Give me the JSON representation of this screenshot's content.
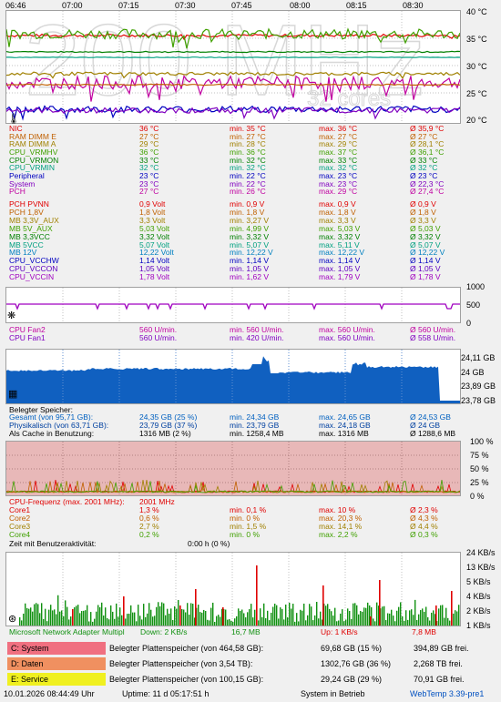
{
  "colors": {
    "red": "#e00000",
    "green": "#00a000",
    "purple": "#a000c0",
    "blue": "#0000e0",
    "olive": "#a09000",
    "memfill": "#1060c0",
    "cpufill": "#e8b8b8",
    "netgreen": "#109010",
    "netred": "#e00000"
  },
  "watermark": {
    "big": "200 MHz",
    "sub": "32 cores"
  },
  "time_axis": [
    "06:46",
    "07:00",
    "07:15",
    "07:30",
    "07:45",
    "08:00",
    "08:15",
    "08:30"
  ],
  "temp_axis": [
    "40 °C",
    "35 °C",
    "30 °C",
    "25 °C",
    "20 °C"
  ],
  "temp_rows": [
    {
      "name": "NIC",
      "cur": "36 °C",
      "min": "min. 35 °C",
      "max": "max. 36 °C",
      "avg": "Ø 35,9 °C",
      "color": "#e00000"
    },
    {
      "name": "RAM DIMM E",
      "cur": "27 °C",
      "min": "min. 27 °C",
      "max": "max. 27 °C",
      "avg": "Ø 27 °C",
      "color": "#c06000"
    },
    {
      "name": "RAM DIMM A",
      "cur": "29 °C",
      "min": "min. 28 °C",
      "max": "max. 29 °C",
      "avg": "Ø 28,1 °C",
      "color": "#a08000"
    },
    {
      "name": "CPU_VRMHV",
      "cur": "36 °C",
      "min": "min. 36 °C",
      "max": "max. 37 °C",
      "avg": "Ø 36,1 °C",
      "color": "#40a000"
    },
    {
      "name": "CPU_VRMON",
      "cur": "33 °C",
      "min": "min. 32 °C",
      "max": "max. 33 °C",
      "avg": "Ø 33 °C",
      "color": "#008000"
    },
    {
      "name": "CPU_VRMIN",
      "cur": "32 °C",
      "min": "min. 32 °C",
      "max": "max. 32 °C",
      "avg": "Ø 32 °C",
      "color": "#00a080"
    },
    {
      "name": "Peripheral",
      "cur": "23 °C",
      "min": "min. 22 °C",
      "max": "max. 23 °C",
      "avg": "Ø 23 °C",
      "color": "#0000c0"
    },
    {
      "name": "System",
      "cur": "23 °C",
      "min": "min. 22 °C",
      "max": "max. 23 °C",
      "avg": "Ø 22,3 °C",
      "color": "#8000c0"
    },
    {
      "name": "PCH",
      "cur": "27 °C",
      "min": "min. 26 °C",
      "max": "max. 29 °C",
      "avg": "Ø 27,4 °C",
      "color": "#c000a0"
    }
  ],
  "volt_rows": [
    {
      "name": "PCH PVNN",
      "cur": "0,9 Volt",
      "min": "min. 0,9 V",
      "max": "max. 0,9 V",
      "avg": "Ø 0,9 V",
      "color": "#e00000"
    },
    {
      "name": "PCH 1,8V",
      "cur": "1,8 Volt",
      "min": "min. 1,8 V",
      "max": "max. 1,8 V",
      "avg": "Ø 1,8 V",
      "color": "#c06000"
    },
    {
      "name": "MB 3,3V_AUX",
      "cur": "3,3 Volt",
      "min": "min. 3,27 V",
      "max": "max. 3,3 V",
      "avg": "Ø 3,3 V",
      "color": "#a08000"
    },
    {
      "name": "MB 5V_AUX",
      "cur": "5,03 Volt",
      "min": "min. 4,99 V",
      "max": "max. 5,03 V",
      "avg": "Ø 5,03 V",
      "color": "#40a000"
    },
    {
      "name": "MB 3,3VCC",
      "cur": "3,32 Volt",
      "min": "min. 3,32 V",
      "max": "max. 3,32 V",
      "avg": "Ø 3,32 V",
      "color": "#008000"
    },
    {
      "name": "MB 5VCC",
      "cur": "5,07 Volt",
      "min": "min. 5,07 V",
      "max": "max. 5,11 V",
      "avg": "Ø 5,07 V",
      "color": "#00a080"
    },
    {
      "name": "MB 12V",
      "cur": "12,22 Volt",
      "min": "min. 12,22 V",
      "max": "max. 12,22 V",
      "avg": "Ø 12,22 V",
      "color": "#0080c0"
    },
    {
      "name": "CPU_VCCHW",
      "cur": "1,14 Volt",
      "min": "min. 1,14 V",
      "max": "max. 1,14 V",
      "avg": "Ø 1,14 V",
      "color": "#0000c0"
    },
    {
      "name": "CPU_VCCON",
      "cur": "1,05 Volt",
      "min": "min. 1,05 V",
      "max": "max. 1,05 V",
      "avg": "Ø 1,05 V",
      "color": "#6000c0"
    },
    {
      "name": "CPU_VCCIN",
      "cur": "1,78 Volt",
      "min": "min. 1,62 V",
      "max": "max. 1,79 V",
      "avg": "Ø 1,78 V",
      "color": "#a000c0"
    }
  ],
  "fan_axis": [
    "1000",
    "500",
    "0"
  ],
  "fan_rows": [
    {
      "name": "CPU Fan2",
      "cur": "560 U/min.",
      "min": "min. 560 U/min.",
      "max": "max. 560 U/min.",
      "avg": "Ø 560 U/min.",
      "color": "#c000a0"
    },
    {
      "name": "CPU Fan1",
      "cur": "560 U/min.",
      "min": "min. 420 U/min.",
      "max": "max. 560 U/min.",
      "avg": "Ø 558 U/min.",
      "color": "#8000c0"
    }
  ],
  "mem_axis": [
    "24,11 GB",
    "24 GB",
    "23,89 GB",
    "23,78 GB"
  ],
  "mem_header": "Belegter Speicher:",
  "mem_rows": [
    {
      "name": "Gesamt (von 95,71 GB):",
      "cur": "24,35 GB (25 %)",
      "min": "min. 24,34 GB",
      "max": "max. 24,65 GB",
      "avg": "Ø 24,53 GB",
      "color": "#0060c0"
    },
    {
      "name": "Physikalisch (von 63,71 GB):",
      "cur": "23,79 GB (37 %)",
      "min": "min. 23,79 GB",
      "max": "max. 24,18 GB",
      "avg": "Ø 24 GB",
      "color": "#0040a0"
    },
    {
      "name": "Als Cache in Benutzung:",
      "cur": "1316 MB (2 %)",
      "min": "min. 1258,4 MB",
      "max": "max. 1316 MB",
      "avg": "Ø 1288,6 MB",
      "color": "#000000"
    }
  ],
  "cpu_axis": [
    "100 %",
    "75 %",
    "50 %",
    "25 %",
    "0 %"
  ],
  "cpu_header": "CPU-Frequenz (max. 2001 MHz):",
  "cpu_header_val": "2001 MHz",
  "cpu_rows": [
    {
      "name": "Core1",
      "cur": "1,3 %",
      "min": "min. 0,1 %",
      "max": "max. 10 %",
      "avg": "Ø 2,3 %",
      "color": "#e00000"
    },
    {
      "name": "Core2",
      "cur": "0,6 %",
      "min": "min. 0 %",
      "max": "max. 20,3 %",
      "avg": "Ø 4,3 %",
      "color": "#c06000"
    },
    {
      "name": "Core3",
      "cur": "2,7 %",
      "min": "min. 1,5 %",
      "max": "max. 14,1 %",
      "avg": "Ø 4,4 %",
      "color": "#a08000"
    },
    {
      "name": "Core4",
      "cur": "0,2 %",
      "min": "min. 0 %",
      "max": "max. 2,2 %",
      "avg": "Ø 0,3 %",
      "color": "#40a000"
    }
  ],
  "user_activity": {
    "label": "Zeit mit Benutzeraktivität:",
    "value": "0:00 h  (0 %)"
  },
  "net_axis": [
    "24 KB/s",
    "13 KB/s",
    "5 KB/s",
    "4 KB/s",
    "2 KB/s",
    "1 KB/s"
  ],
  "net": {
    "adapter": "Microsoft Network Adapter Multipl",
    "down": "Down: 2 KB/s",
    "down_total": "16,7 MB",
    "up": "Up: 1 KB/s",
    "up_total": "7,8 MB"
  },
  "drives": [
    {
      "letter": "C: System",
      "label": "Belegter Plattenspeicher (von 464,58 GB):",
      "used": "69,68 GB (15 %)",
      "free": "394,89 GB frei.",
      "color": "#f07080"
    },
    {
      "letter": "D: Daten",
      "label": "Belegter Plattenspeicher (von 3,54 TB):",
      "used": "1302,76 GB (36 %)",
      "free": "2,268 TB frei.",
      "color": "#f09060"
    },
    {
      "letter": "E: Service",
      "label": "Belegter Plattenspeicher (von 100,15 GB):",
      "used": "29,24 GB (29 %)",
      "free": "70,91 GB frei.",
      "color": "#f0f020"
    }
  ],
  "status": {
    "datetime": "10.01.2026 08:44:49 Uhr",
    "uptime": "Uptime: 11 d 05:17:51 h",
    "service": "System in Betrieb",
    "app": "WebTemp 3.39-pre1"
  }
}
